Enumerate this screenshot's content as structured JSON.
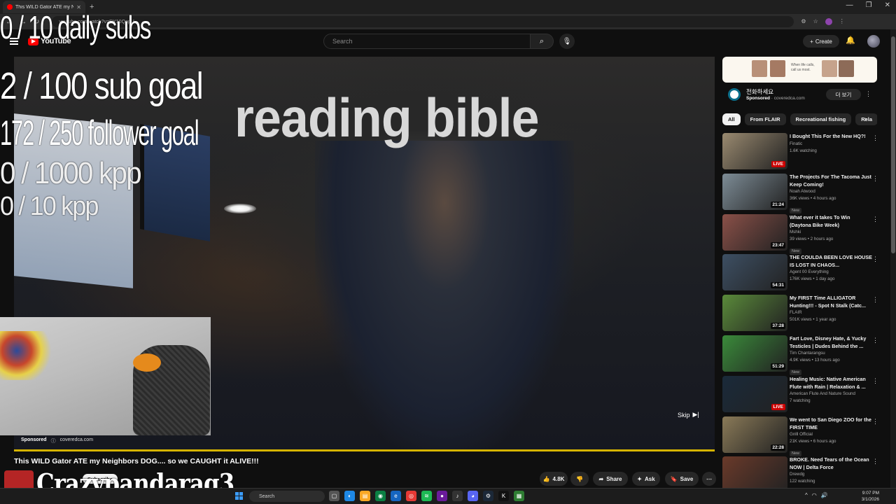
{
  "browser": {
    "tab_title": "This WILD Gator ATE my N...",
    "url": "youtube.com/watch?v=RY10QopU",
    "window_controls": [
      "—",
      "❐",
      "✕"
    ]
  },
  "masthead": {
    "logo_text": "YouTube",
    "search_placeholder": "Search",
    "create_label": "Create"
  },
  "stream_overlay": {
    "daily_subs": "0 / 10 daily subs",
    "sub_goal": "2  / 100 sub goal",
    "follower_goal": "172 / 250 follower goal",
    "kpp_1000": "0 / 1000 kpp",
    "kpp_10": "0 / 10 kpp",
    "watermark": "Crazypandarag3"
  },
  "player": {
    "overlay_text": "reading bible",
    "skip_label": "Skip",
    "ad_label": "Sponsored",
    "ad_domain": "coveredca.com",
    "progress_fraction": 1.0
  },
  "video": {
    "title": "This WILD Gator ATE my Neighbors DOG.... so we CAUGHT it ALIVE!!!",
    "subscribe_label": "Subscribe",
    "like_count": "4.8K",
    "share_label": "Share",
    "ask_label": "Ask",
    "save_label": "Save"
  },
  "sidebar_ad": {
    "banner_caption": "When life calls, call us most.",
    "title": "전화하세요",
    "sponsored": "Sponsored",
    "domain": "coveredca.com",
    "cta": "더 보기"
  },
  "chips": [
    "All",
    "From FLAIR",
    "Recreational fishing",
    "Rela"
  ],
  "recommendations": [
    {
      "title": "I Bought This For the New HQ?!",
      "channel": "Finatic",
      "meta": "1.6K watching",
      "badge": "LIVE",
      "new": false,
      "color": "#9a8a70"
    },
    {
      "title": "The Projects For The Tacoma Just Keep Coming!",
      "channel": "Noah Atwood",
      "meta": "36K views • 4 hours ago",
      "badge": "21:24",
      "new": true,
      "color": "#7d8c96"
    },
    {
      "title": "What ever it takes To Win (Daytona Bike Week)",
      "channel": "Mshki",
      "meta": "39 views • 2 hours ago",
      "badge": "23:47",
      "new": true,
      "color": "#8a5048"
    },
    {
      "title": "THE COULDA BEEN LOVE HOUSE IS LOST IN CHAOS...",
      "channel": "Agent 00 Everything",
      "meta": "176K views • 1 day ago",
      "badge": "54:31",
      "new": false,
      "color": "#3d4f63"
    },
    {
      "title": "My FIRST Time ALLIGATOR Hunting!!! - Spot N Stalk (Catc...",
      "channel": "FLAIR",
      "meta": "501K views • 1 year ago",
      "badge": "37:28",
      "new": false,
      "color": "#5a8a3a"
    },
    {
      "title": "Fart Love, Disney Hate, & Yucky Testicles | Dudes Behind the ...",
      "channel": "Tim Chantarangsu",
      "meta": "4.9K views • 13 hours ago",
      "badge": "51:29",
      "new": true,
      "color": "#3a8a3a"
    },
    {
      "title": "Healing Music: Native American Flute with Rain | Relaxation & ...",
      "channel": "American Flute And Nature Sound",
      "meta": "7 watching",
      "badge": "LIVE",
      "new": false,
      "color": "#1a2a3a"
    },
    {
      "title": "We went to San Diego ZOO for the FIRST TIME",
      "channel": "Gnlll Official",
      "meta": "21K views • 6 hours ago",
      "badge": "22:28",
      "new": true,
      "color": "#8a7a58"
    },
    {
      "title": "BROKE. Need Tears of the Ocean NOW | Delta Force",
      "channel": "Drewdg",
      "meta": "122 watching",
      "badge": "",
      "new": false,
      "color": "#6a3a2a"
    }
  ],
  "taskbar": {
    "search_placeholder": "Search",
    "time": "9:07 PM",
    "date": "3/1/2026"
  }
}
